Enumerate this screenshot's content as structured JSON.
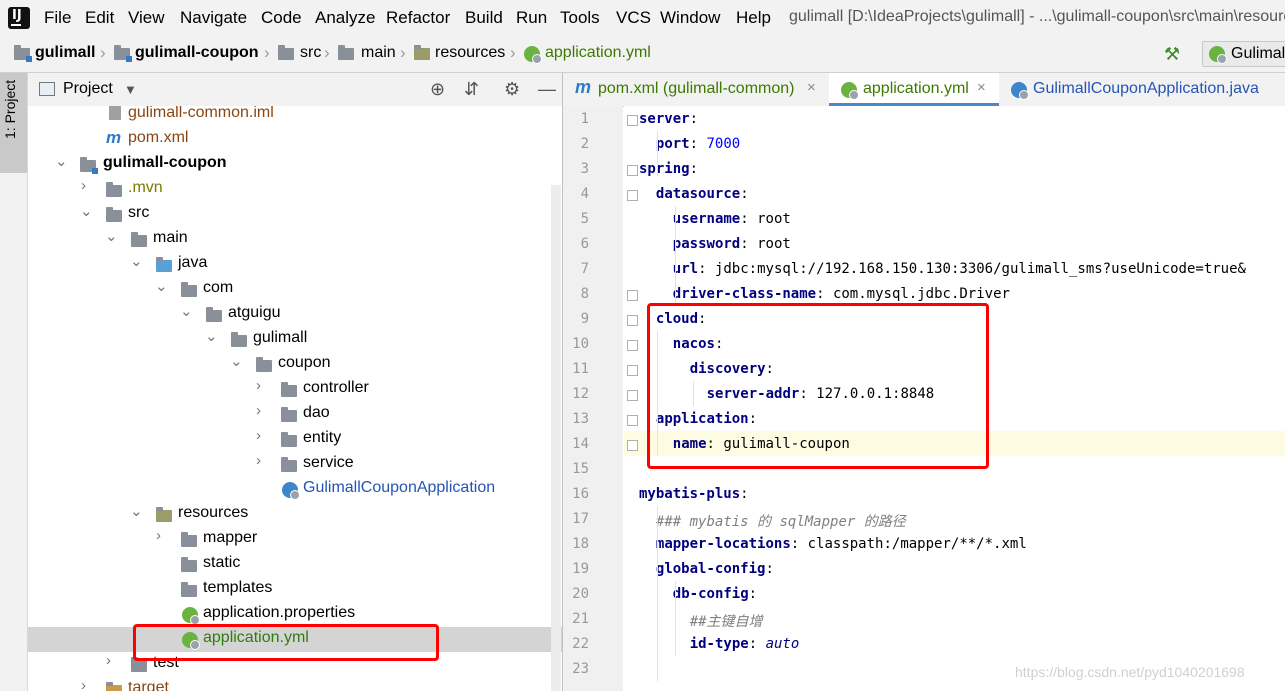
{
  "menubar": {
    "items": [
      "File",
      "Edit",
      "View",
      "Navigate",
      "Code",
      "Analyze",
      "Refactor",
      "Build",
      "Run",
      "Tools",
      "VCS",
      "Window",
      "Help"
    ],
    "window_title": "gulimall [D:\\IdeaProjects\\gulimall] - ...\\gulimall-coupon\\src\\main\\resources"
  },
  "breadcrumb": [
    "gulimall",
    "gulimall-coupon",
    "src",
    "main",
    "resources",
    "application.yml"
  ],
  "run_config": "Gulimall",
  "side_tab": "1: Project",
  "project_panel": {
    "title": "Project",
    "tree": [
      {
        "label": "gulimall-common.iml",
        "color": "brown",
        "icon": "iml-file-icon"
      },
      {
        "label": "pom.xml",
        "color": "brown",
        "icon": "maven-icon"
      },
      {
        "label": "gulimall-coupon",
        "bold": true,
        "icon": "module-folder-icon"
      },
      {
        "label": ".mvn",
        "color": "olive",
        "icon": "folder-icon"
      },
      {
        "label": "src",
        "icon": "folder-icon"
      },
      {
        "label": "main",
        "icon": "folder-icon"
      },
      {
        "label": "java",
        "icon": "source-folder-icon"
      },
      {
        "label": "com",
        "icon": "package-icon"
      },
      {
        "label": "atguigu",
        "icon": "package-icon"
      },
      {
        "label": "gulimall",
        "icon": "package-icon"
      },
      {
        "label": "coupon",
        "icon": "package-icon"
      },
      {
        "label": "controller",
        "icon": "package-icon"
      },
      {
        "label": "dao",
        "icon": "package-icon"
      },
      {
        "label": "entity",
        "icon": "package-icon"
      },
      {
        "label": "service",
        "icon": "package-icon"
      },
      {
        "label": "GulimallCouponApplication",
        "color": "blue",
        "icon": "spring-class-icon"
      },
      {
        "label": "resources",
        "icon": "resources-folder-icon"
      },
      {
        "label": "mapper",
        "icon": "folder-icon"
      },
      {
        "label": "static",
        "icon": "folder-icon"
      },
      {
        "label": "templates",
        "icon": "folder-icon"
      },
      {
        "label": "application.properties",
        "icon": "spring-config-icon"
      },
      {
        "label": "application.yml",
        "color": "green",
        "icon": "spring-config-icon",
        "selected": true
      },
      {
        "label": "test",
        "icon": "folder-icon"
      },
      {
        "label": "target",
        "color": "brown",
        "icon": "folder-icon"
      }
    ]
  },
  "editor": {
    "tabs": [
      {
        "label": "pom.xml (gulimall-common)",
        "icon": "maven-icon",
        "close": "×"
      },
      {
        "label": "application.yml",
        "icon": "spring-config-icon",
        "active": true,
        "close": "×"
      },
      {
        "label": "GulimallCouponApplication.java",
        "icon": "spring-class-icon"
      }
    ],
    "current_line": 14,
    "lines": [
      {
        "n": "1",
        "key": "server",
        "rest": ":"
      },
      {
        "n": "2",
        "key": "port",
        "rest": ": ",
        "num": "7000"
      },
      {
        "n": "3",
        "key": "spring",
        "rest": ":"
      },
      {
        "n": "4",
        "key": "datasource",
        "rest": ":"
      },
      {
        "n": "5",
        "key": "username",
        "rest": ": root"
      },
      {
        "n": "6",
        "key": "password",
        "rest": ": root"
      },
      {
        "n": "7",
        "key": "url",
        "rest": ": jdbc:mysql://192.168.150.130:3306/gulimall_sms?useUnicode=true&"
      },
      {
        "n": "8",
        "key": "driver-class-name",
        "rest": ": com.mysql.jdbc.Driver"
      },
      {
        "n": "9",
        "key": "cloud",
        "rest": ":"
      },
      {
        "n": "10",
        "key": "nacos",
        "rest": ":"
      },
      {
        "n": "11",
        "key": "discovery",
        "rest": ":"
      },
      {
        "n": "12",
        "key": "server-addr",
        "rest": ": 127.0.0.1:8848"
      },
      {
        "n": "13",
        "key": "application",
        "rest": ":"
      },
      {
        "n": "14",
        "key": "name",
        "rest": ": gulimall-coupon"
      },
      {
        "n": "15",
        "key": "",
        "rest": ""
      },
      {
        "n": "16",
        "key": "mybatis-plus",
        "rest": ":"
      },
      {
        "n": "17",
        "comment": "### mybatis 的 sqlMapper 的路径"
      },
      {
        "n": "18",
        "key": "mapper-locations",
        "rest": ": classpath:/mapper/**/*.xml"
      },
      {
        "n": "19",
        "key": "global-config",
        "rest": ":"
      },
      {
        "n": "20",
        "key": "db-config",
        "rest": ":"
      },
      {
        "n": "21",
        "comment": "##主键自增"
      },
      {
        "n": "22",
        "key": "id-type",
        "rest": ": ",
        "kw": "auto"
      },
      {
        "n": "23",
        "key": "",
        "rest": ""
      }
    ]
  },
  "watermark": "https://blog.csdn.net/pyd1040201698"
}
